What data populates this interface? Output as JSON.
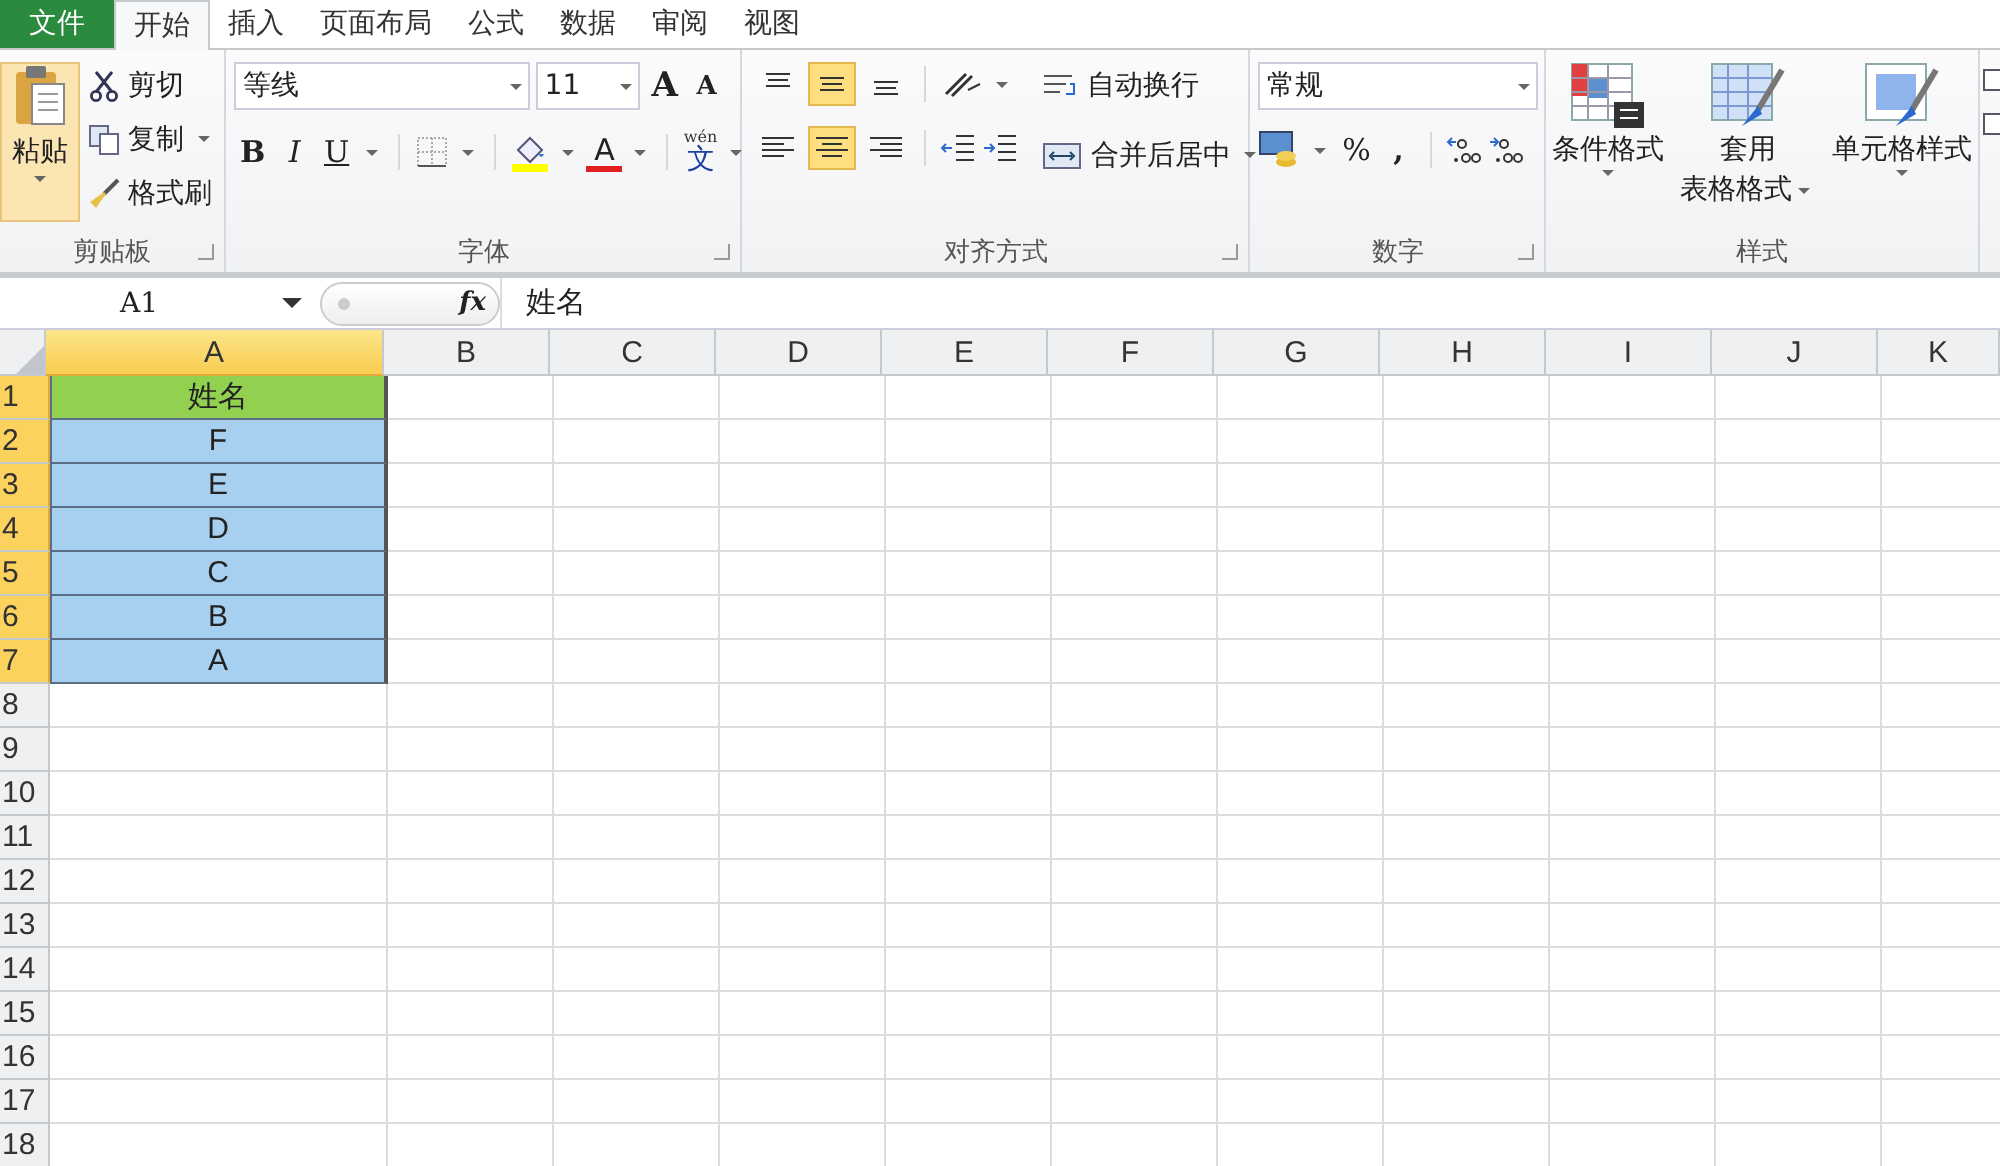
{
  "file_tab": "文件",
  "tabs": [
    {
      "label": "开始",
      "selected": true
    },
    {
      "label": "插入",
      "selected": false
    },
    {
      "label": "页面布局",
      "selected": false
    },
    {
      "label": "公式",
      "selected": false
    },
    {
      "label": "数据",
      "selected": false
    },
    {
      "label": "审阅",
      "selected": false
    },
    {
      "label": "视图",
      "selected": false
    }
  ],
  "clipboard": {
    "title": "剪贴板",
    "paste": "粘贴",
    "cut": "剪切",
    "copy": "复制",
    "painter": "格式刷"
  },
  "font": {
    "title": "字体",
    "family": "等线",
    "size": "11",
    "grow": "A",
    "shrink": "A",
    "bold": "B",
    "italic": "I",
    "underline": "U",
    "font_color": "A",
    "phonetic_pinyin": "wén",
    "phonetic_char": "文"
  },
  "alignment": {
    "title": "对齐方式",
    "wrap": "自动换行",
    "merge": "合并后居中",
    "vertical": [
      {
        "selected": false
      },
      {
        "selected": true
      },
      {
        "selected": false
      }
    ],
    "horizontal": [
      {
        "selected": false
      },
      {
        "selected": true
      },
      {
        "selected": false
      }
    ]
  },
  "number": {
    "title": "数字",
    "format": "常规",
    "percent": "%",
    "comma": ","
  },
  "styles": {
    "title": "样式",
    "conditional": "条件格式",
    "table_line1": "套用",
    "table_line2": "表格格式",
    "cell_styles": "单元格样式"
  },
  "formula_bar": {
    "name_box": "A1",
    "fx": "fx",
    "value": "姓名"
  },
  "sheet": {
    "columns": [
      {
        "label": "A",
        "selected": true
      },
      {
        "label": "B",
        "selected": false
      },
      {
        "label": "C",
        "selected": false
      },
      {
        "label": "D",
        "selected": false
      },
      {
        "label": "E",
        "selected": false
      },
      {
        "label": "F",
        "selected": false
      },
      {
        "label": "G",
        "selected": false
      },
      {
        "label": "H",
        "selected": false
      },
      {
        "label": "I",
        "selected": false
      },
      {
        "label": "J",
        "selected": false
      },
      {
        "label": "K",
        "selected": false
      }
    ],
    "rows": [
      {
        "label": "1",
        "selected": true,
        "cells": [
          {
            "text": "姓名",
            "color": "#92d050"
          }
        ]
      },
      {
        "label": "2",
        "selected": true,
        "cells": [
          {
            "text": "F",
            "color": "#a6cff0"
          }
        ]
      },
      {
        "label": "3",
        "selected": true,
        "cells": [
          {
            "text": "E",
            "color": "#a6cff0"
          }
        ]
      },
      {
        "label": "4",
        "selected": true,
        "cells": [
          {
            "text": "D",
            "color": "#a6cff0"
          }
        ]
      },
      {
        "label": "5",
        "selected": true,
        "cells": [
          {
            "text": "C",
            "color": "#a6cff0"
          }
        ]
      },
      {
        "label": "6",
        "selected": true,
        "cells": [
          {
            "text": "B",
            "color": "#a6cff0"
          }
        ]
      },
      {
        "label": "7",
        "selected": true,
        "cells": [
          {
            "text": "A",
            "color": "#a6cff0"
          }
        ]
      },
      {
        "label": "8",
        "selected": false
      },
      {
        "label": "9",
        "selected": false
      },
      {
        "label": "10",
        "selected": false
      },
      {
        "label": "11",
        "selected": false
      },
      {
        "label": "12",
        "selected": false
      },
      {
        "label": "13",
        "selected": false
      },
      {
        "label": "14",
        "selected": false
      },
      {
        "label": "15",
        "selected": false
      },
      {
        "label": "16",
        "selected": false
      },
      {
        "label": "17",
        "selected": false
      },
      {
        "label": "18",
        "selected": false
      }
    ]
  }
}
